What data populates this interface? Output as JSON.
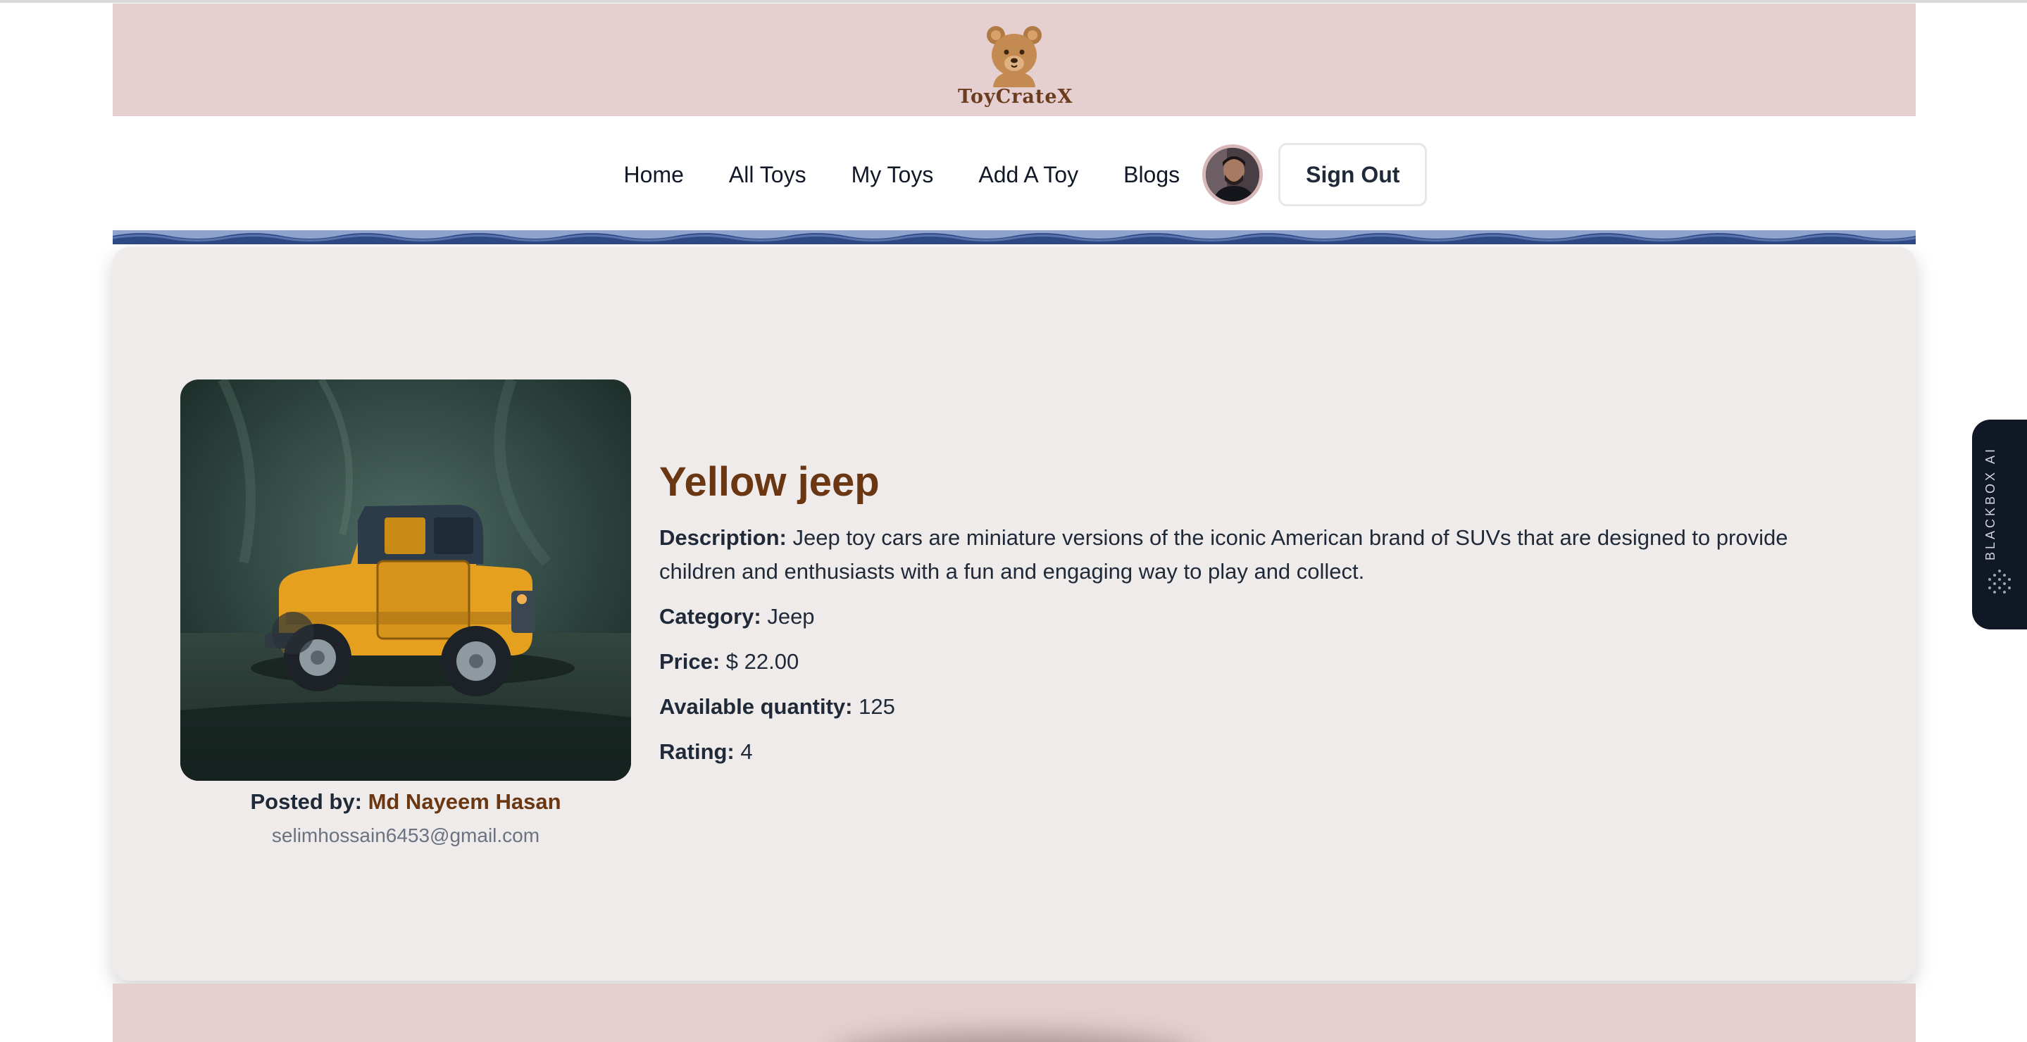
{
  "brand": {
    "name": "ToyCrateX"
  },
  "nav": {
    "items": [
      "Home",
      "All Toys",
      "My Toys",
      "Add A Toy",
      "Blogs"
    ],
    "signout_label": "Sign Out"
  },
  "product": {
    "title": "Yellow jeep",
    "description_label": "Description:",
    "description": "Jeep toy cars are miniature versions of the iconic American brand of SUVs that are designed to provide children and enthusiasts with a fun and engaging way to play and collect.",
    "category_label": "Category:",
    "category": "Jeep",
    "price_label": "Price:",
    "price": "$ 22.00",
    "quantity_label": "Available quantity:",
    "quantity": "125",
    "rating_label": "Rating:",
    "rating": "4",
    "image_icon": "yellow-jeep-photo"
  },
  "poster": {
    "label": "Posted by:",
    "name": "Md Nayeem Hasan",
    "email": "selimhossain6453@gmail.com"
  },
  "side_widget": {
    "label": "BLACKBOX AI"
  },
  "colors": {
    "header_bg": "#e5cfd0",
    "accent_brown": "#6b3712",
    "card_bg": "#efebeb",
    "wave_blue": "#2f4a86"
  }
}
